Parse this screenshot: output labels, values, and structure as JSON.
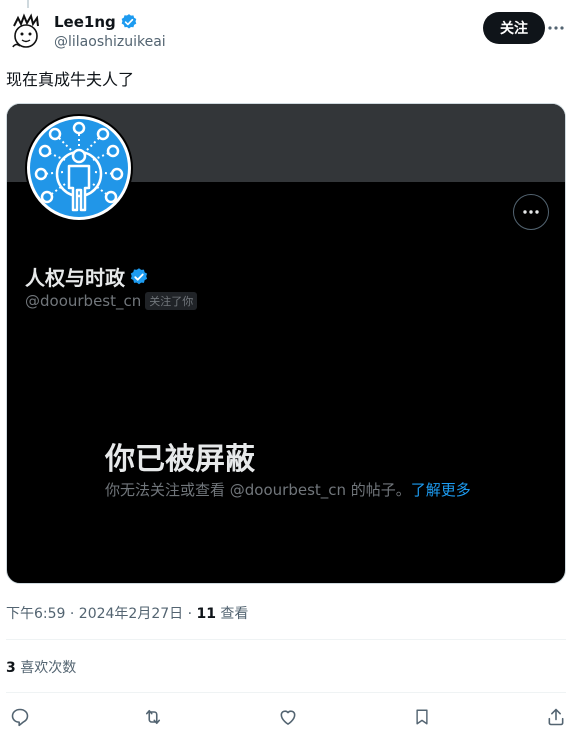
{
  "author": {
    "name": "Lee1ng",
    "handle": "@lilaoshizuikeai"
  },
  "follow_label": "关注",
  "tweet_text": "现在真成牛夫人了",
  "card": {
    "name": "人权与时政",
    "handle": "@doourbest_cn",
    "follows_you": "关注了你",
    "blocked_title": "你已被屏蔽",
    "blocked_desc": "你无法关注或查看 @doourbest_cn 的帖子。",
    "learn_more": "了解更多"
  },
  "meta": {
    "timestamp": "下午6:59 · 2024年2月27日 · ",
    "views_count": "11",
    "views_label": " 查看"
  },
  "likes": {
    "count": "3",
    "label": " 喜欢次数"
  },
  "colors": {
    "verified_blue": "#1d9bf0",
    "avatar_blue": "#2196e8",
    "text_primary": "#0f1419",
    "text_secondary": "#536471"
  },
  "icons": [
    "reply-icon",
    "retweet-icon",
    "like-icon",
    "bookmark-icon",
    "share-icon",
    "more-icon",
    "verified-badge-icon"
  ]
}
